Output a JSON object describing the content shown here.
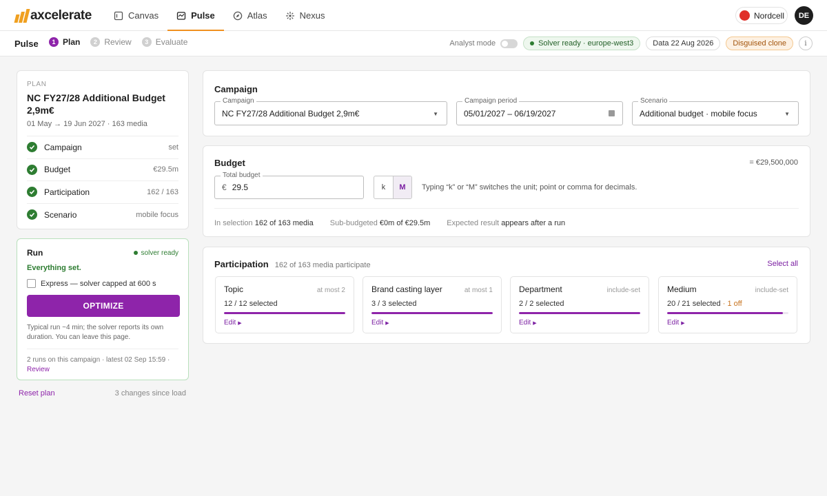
{
  "app": {
    "brand": "axcelerate"
  },
  "nav": [
    {
      "label": "Canvas",
      "icon": "canvas-icon",
      "active": false
    },
    {
      "label": "Pulse",
      "icon": "pulse-icon",
      "active": true
    },
    {
      "label": "Atlas",
      "icon": "compass-icon",
      "active": false
    },
    {
      "label": "Nexus",
      "icon": "nexus-icon",
      "active": false
    }
  ],
  "org": {
    "name": "Nordcell"
  },
  "user": {
    "initials": "DE"
  },
  "subbar": {
    "title": "Pulse",
    "steps": [
      {
        "num": "1",
        "label": "Plan",
        "active": true
      },
      {
        "num": "2",
        "label": "Review",
        "active": false
      },
      {
        "num": "3",
        "label": "Evaluate",
        "active": false
      }
    ],
    "analyst_mode": "Analyst mode",
    "solver_status": "Solver ready · europe-west3",
    "data_date": "Data 22 Aug 2026",
    "clone_badge": "Disguised clone",
    "info": "i"
  },
  "plan": {
    "kicker": "PLAN",
    "title": "NC FY27/28 Additional Budget 2,9m€",
    "subtitle": "01 May → 19 Jun 2027 · 163 media",
    "items": [
      {
        "label": "Campaign",
        "value": "set"
      },
      {
        "label": "Budget",
        "value": "€29.5m"
      },
      {
        "label": "Participation",
        "value": "162 / 163"
      },
      {
        "label": "Scenario",
        "value": "mobile focus"
      }
    ]
  },
  "run": {
    "title": "Run",
    "status": "solver ready",
    "ok": "Everything set.",
    "express": "Express — solver capped at 600 s",
    "optimize": "OPTIMIZE",
    "note": "Typical run ~4 min; the solver reports its own duration. You can leave this page.",
    "footer": "2 runs on this campaign · latest 02 Sep 15:59 ·",
    "review_link": "Review"
  },
  "below": {
    "reset": "Reset plan",
    "changes": "3 changes since load"
  },
  "campaign": {
    "title": "Campaign",
    "campaign_label": "Campaign",
    "campaign_value": "NC FY27/28 Additional Budget 2,9m€",
    "period_label": "Campaign period",
    "period_value": "05/01/2027 – 06/19/2027",
    "scenario_label": "Scenario",
    "scenario_value": "Additional budget · mobile focus"
  },
  "budget": {
    "title": "Budget",
    "total_eq": "= €29,500,000",
    "total_label": "Total budget",
    "currency": "€",
    "value": "29.5",
    "unit_k": "k",
    "unit_m": "M",
    "hint": "Typing “k” or “M” switches the unit; point or comma for decimals.",
    "stats": {
      "sel_label": "In selection",
      "sel_value": "162 of 163 media",
      "sub_label": "Sub-budgeted",
      "sub_value": "€0m of €29.5m",
      "exp_label": "Expected result",
      "exp_value": "appears after a run"
    }
  },
  "participation": {
    "title": "Participation",
    "count": "162 of 163 media participate",
    "select_all": "Select all",
    "dims": [
      {
        "name": "Topic",
        "rule": "at most 2",
        "selected": "12 / 12 selected",
        "off": "",
        "fill": 1.0,
        "edit": "Edit"
      },
      {
        "name": "Brand casting layer",
        "rule": "at most 1",
        "selected": "3 / 3 selected",
        "off": "",
        "fill": 1.0,
        "edit": "Edit"
      },
      {
        "name": "Department",
        "rule": "include-set",
        "selected": "2 / 2 selected",
        "off": "",
        "fill": 1.0,
        "edit": "Edit"
      },
      {
        "name": "Medium",
        "rule": "include-set",
        "selected": "20 / 21 selected",
        "off": "· 1 off",
        "fill": 0.952,
        "edit": "Edit"
      }
    ]
  },
  "colors": {
    "accent": "#8e24aa",
    "brand": "#f0a020",
    "success": "#2e7d32"
  }
}
